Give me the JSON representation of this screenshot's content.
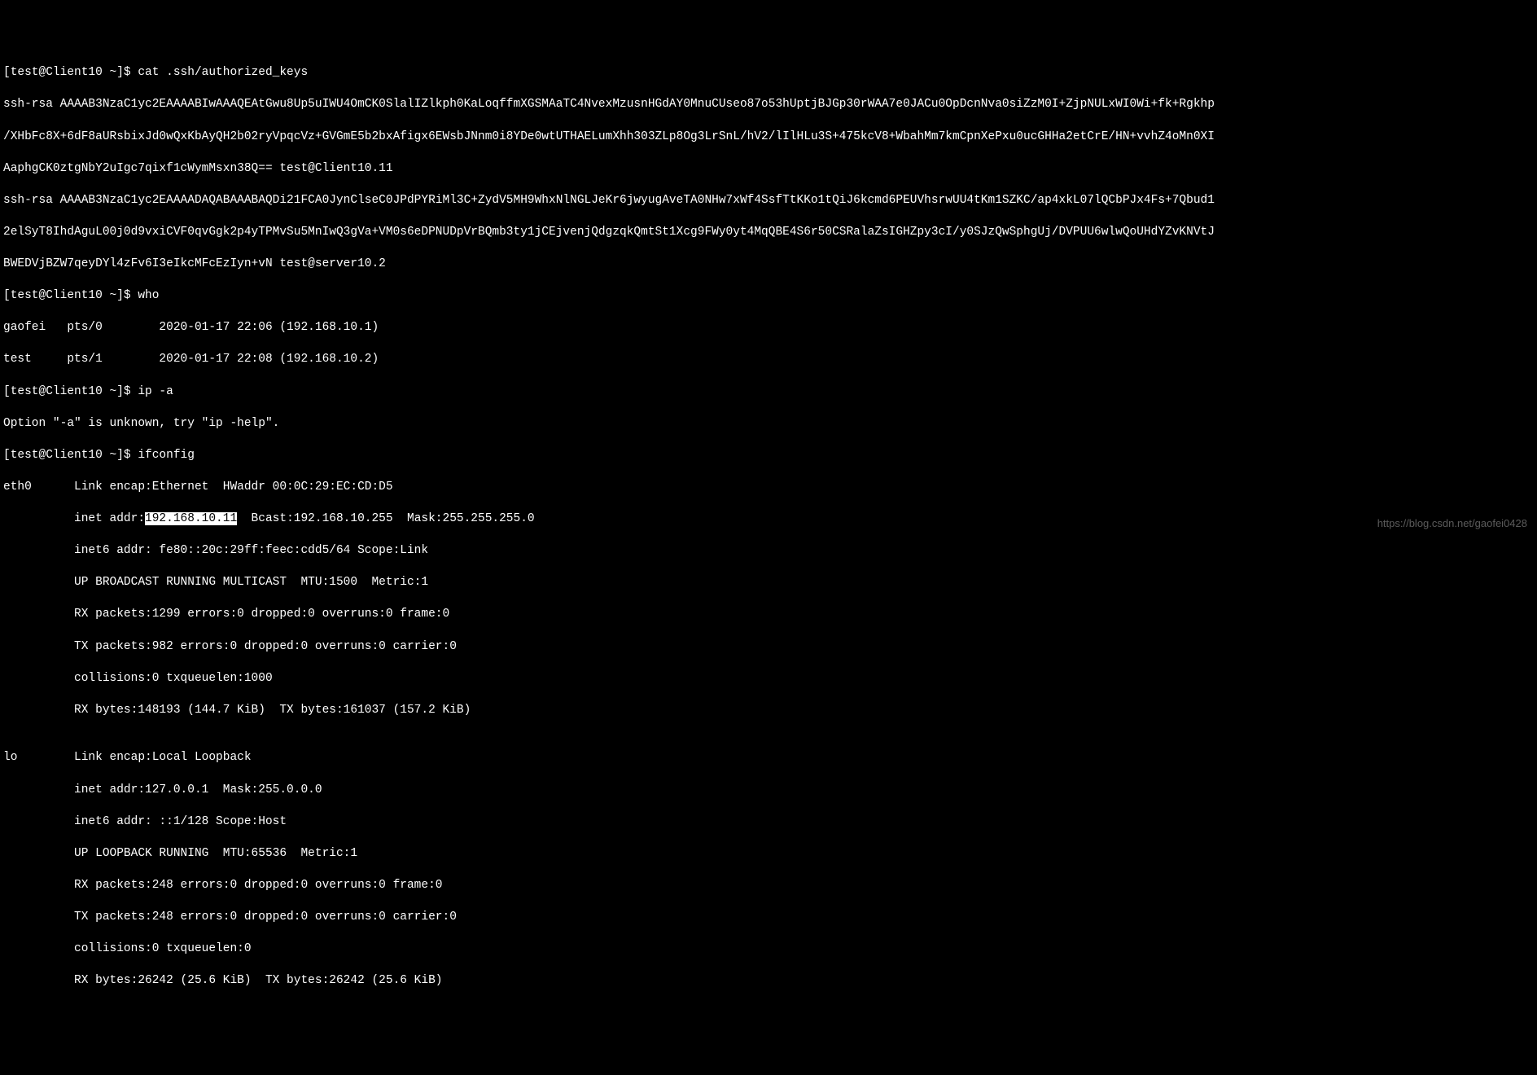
{
  "terminal": {
    "prompt": "[test@Client10 ~]$ ",
    "cmd_cat": "cat .ssh/authorized_keys",
    "authorized_keys": {
      "line1": "ssh-rsa AAAAB3NzaC1yc2EAAAABIwAAAQEAtGwu8Up5uIWU4OmCK0SlalIZlkph0KaLoqffmXGSMAaTC4NvexMzusnHGdAY0MnuCUseo87o53hUptjBJGp30rWAA7e0JACu0OpDcnNva0siZzM0I+ZjpNULxWI0Wi+fk+Rgkhp",
      "line2": "/XHbFc8X+6dF8aURsbixJd0wQxKbAyQH2b02ryVpqcVz+GVGmE5b2bxAfigx6EWsbJNnm0i8YDe0wtUTHAELumXhh303ZLp8Og3LrSnL/hV2/lIlHLu3S+475kcV8+WbahMm7kmCpnXePxu0ucGHHa2etCrE/HN+vvhZ4oMn0XI",
      "line3": "AaphgCK0ztgNbY2uIgc7qixf1cWymMsxn38Q== test@Client10.11",
      "line4": "ssh-rsa AAAAB3NzaC1yc2EAAAADAQABAAABAQDi21FCA0JynClseC0JPdPYRiMl3C+ZydV5MH9WhxNlNGLJeKr6jwyugAveTA0NHw7xWf4SsfTtKKo1tQiJ6kcmd6PEUVhsrwUU4tKm1SZKC/ap4xkL07lQCbPJx4Fs+7Qbud1",
      "line5": "2elSyT8IhdAguL00j0d9vxiCVF0qvGgk2p4yTPMvSu5MnIwQ3gVa+VM0s6eDPNUDpVrBQmb3ty1jCEjvenjQdgzqkQmtSt1Xcg9FWy0yt4MqQBE4S6r50CSRalaZsIGHZpy3cI/y0SJzQwSphgUj/DVPUU6wlwQoUHdYZvKNVtJ",
      "line6": "BWEDVjBZW7qeyDYl4zFv6I3eIkcMFcEzIyn+vN test@server10.2"
    },
    "cmd_who": "who",
    "who_output": {
      "line1": "gaofei   pts/0        2020-01-17 22:06 (192.168.10.1)",
      "line2": "test     pts/1        2020-01-17 22:08 (192.168.10.2)"
    },
    "cmd_ip": "ip -a",
    "ip_error": "Option \"-a\" is unknown, try \"ip -help\".",
    "cmd_ifconfig": "ifconfig",
    "ifconfig": {
      "eth0_l1": "eth0      Link encap:Ethernet  HWaddr 00:0C:29:EC:CD:D5",
      "eth0_l2_pre": "          inet addr:",
      "eth0_l2_hl": "192.168.10.11",
      "eth0_l2_post": "  Bcast:192.168.10.255  Mask:255.255.255.0",
      "eth0_l3": "          inet6 addr: fe80::20c:29ff:feec:cdd5/64 Scope:Link",
      "eth0_l4": "          UP BROADCAST RUNNING MULTICAST  MTU:1500  Metric:1",
      "eth0_l5": "          RX packets:1299 errors:0 dropped:0 overruns:0 frame:0",
      "eth0_l6": "          TX packets:982 errors:0 dropped:0 overruns:0 carrier:0",
      "eth0_l7": "          collisions:0 txqueuelen:1000",
      "eth0_l8": "          RX bytes:148193 (144.7 KiB)  TX bytes:161037 (157.2 KiB)",
      "blank": "",
      "lo_l1": "lo        Link encap:Local Loopback",
      "lo_l2": "          inet addr:127.0.0.1  Mask:255.0.0.0",
      "lo_l3": "          inet6 addr: ::1/128 Scope:Host",
      "lo_l4": "          UP LOOPBACK RUNNING  MTU:65536  Metric:1",
      "lo_l5": "          RX packets:248 errors:0 dropped:0 overruns:0 frame:0",
      "lo_l6": "          TX packets:248 errors:0 dropped:0 overruns:0 carrier:0",
      "lo_l7": "          collisions:0 txqueuelen:0",
      "lo_l8": "          RX bytes:26242 (25.6 KiB)  TX bytes:26242 (25.6 KiB)"
    }
  },
  "watermark": "https://blog.csdn.net/gaofei0428"
}
